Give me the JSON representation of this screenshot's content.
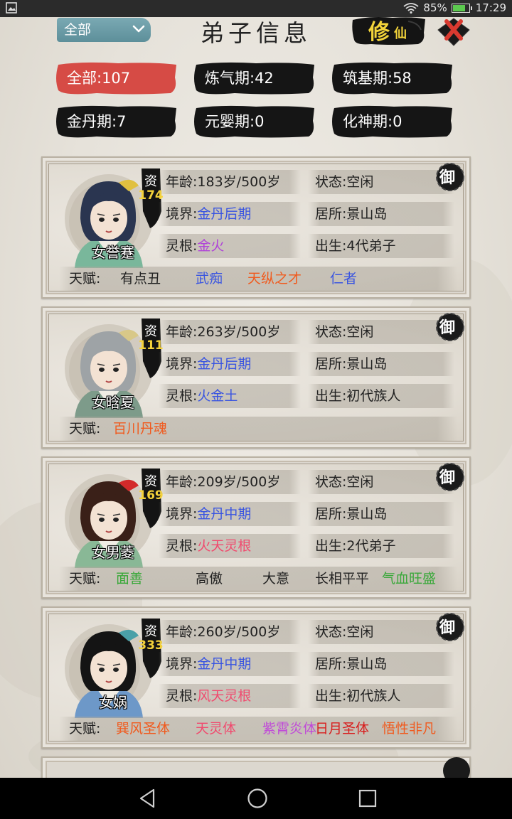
{
  "status_bar": {
    "battery": "85%",
    "time": "17:29",
    "battery_level": 0.85
  },
  "header": {
    "filter": {
      "selected": "全部"
    },
    "title": "弟子信息",
    "xiu_button": {
      "big": "修",
      "small": "仙"
    }
  },
  "stages": [
    {
      "label": "全部:107",
      "active": true
    },
    {
      "label": "炼气期:42"
    },
    {
      "label": "筑基期:58"
    },
    {
      "label": "金丹期:7"
    },
    {
      "label": "元婴期:0"
    },
    {
      "label": "化神期:0"
    }
  ],
  "disciples": [
    {
      "name": "女誉蹇",
      "zi": "资",
      "aptitude": "174",
      "age_label": "年龄:",
      "age": "183岁/500岁",
      "status_label": "状态:",
      "status": "空闲",
      "realm_label": "境界:",
      "realm": "金丹后期",
      "home_label": "居所:",
      "home": "景山岛",
      "root_label": "灵根:",
      "root": "金火",
      "birth_label": "出生:",
      "birth": "4代弟子",
      "talent_label": "天赋:",
      "talents": [
        {
          "text": "有点丑",
          "color": "#222222"
        },
        {
          "text": "武痴",
          "color": "#3a55e0"
        },
        {
          "text": "天纵之才",
          "color": "#f05a1e"
        },
        {
          "text": "仁者",
          "color": "#3a55e0"
        }
      ],
      "seal": "御"
    },
    {
      "name": "女晗夏",
      "zi": "资",
      "aptitude": "111",
      "age_label": "年龄:",
      "age": "263岁/500岁",
      "status_label": "状态:",
      "status": "空闲",
      "realm_label": "境界:",
      "realm": "金丹后期",
      "home_label": "居所:",
      "home": "景山岛",
      "root_label": "灵根:",
      "root": "火金土",
      "birth_label": "出生:",
      "birth": "初代族人",
      "talent_label": "天赋:",
      "talents": [
        {
          "text": "百川丹魂",
          "color": "#f05a1e"
        }
      ],
      "seal": "御"
    },
    {
      "name": "女男菱",
      "zi": "资",
      "aptitude": "169",
      "age_label": "年龄:",
      "age": "209岁/500岁",
      "status_label": "状态:",
      "status": "空闲",
      "realm_label": "境界:",
      "realm": "金丹中期",
      "home_label": "居所:",
      "home": "景山岛",
      "root_label": "灵根:",
      "root": "火天灵根",
      "birth_label": "出生:",
      "birth": "2代弟子",
      "talent_label": "天赋:",
      "talents": [
        {
          "text": "面善",
          "color": "#3aa83a"
        },
        {
          "text": "高傲",
          "color": "#222222"
        },
        {
          "text": "大意",
          "color": "#222222"
        },
        {
          "text": "长相平平",
          "color": "#222222"
        },
        {
          "text": "气血旺盛",
          "color": "#3aa83a"
        }
      ],
      "seal": "御"
    },
    {
      "name": "女娲",
      "zi": "资",
      "aptitude": "333",
      "age_label": "年龄:",
      "age": "260岁/500岁",
      "status_label": "状态:",
      "status": "空闲",
      "realm_label": "境界:",
      "realm": "金丹中期",
      "home_label": "居所:",
      "home": "景山岛",
      "root_label": "灵根:",
      "root": "风天灵根",
      "birth_label": "出生:",
      "birth": "初代族人",
      "talent_label": "天赋:",
      "talents": [
        {
          "text": "巽风圣体",
          "color": "#f05a1e"
        },
        {
          "text": "天灵体",
          "color": "#f04a6e"
        },
        {
          "text": "紫霄炎体",
          "color": "#c04ad8"
        },
        {
          "text": "日月圣体",
          "color": "#d81e1e"
        },
        {
          "text": "悟性非凡",
          "color": "#f05a1e"
        }
      ],
      "seal": "御"
    }
  ],
  "colors": {
    "active_tab": "#d64b45",
    "tab": "#151515",
    "blue_value": "#3a55e0",
    "purple_value": "#b044d8",
    "pink_value": "#f04a6e",
    "zi_value": "#f4d23a"
  }
}
